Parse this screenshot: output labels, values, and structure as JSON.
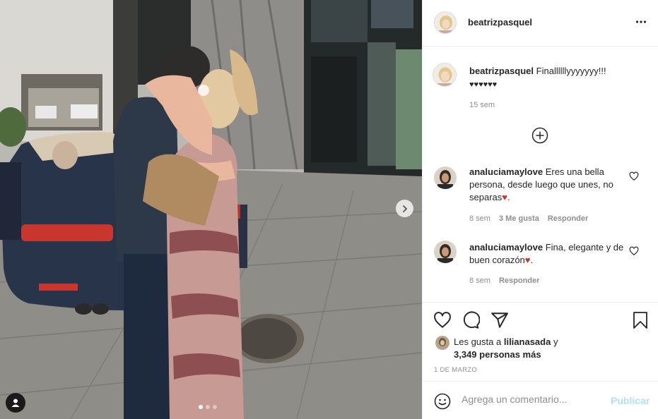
{
  "post": {
    "author": "beatrizpasquel",
    "media": {
      "slide_index": 1,
      "slide_count": 3
    }
  },
  "caption": {
    "username": "beatrizpasquel",
    "text": "Finallllllyyyyyyy!!!",
    "hearts": "♥♥♥♥♥♥",
    "age": "15 sem"
  },
  "comments": [
    {
      "username": "analuciamaylove",
      "text_before": "Eres una bella persona, desde luego que unes, no separas",
      "heart": "♥",
      "text_after": ".",
      "age": "8 sem",
      "likes": "3 Me gusta",
      "reply": "Responder"
    },
    {
      "username": "analuciamaylove",
      "text_before": "Fina, elegante y de buen corazón",
      "heart": "♥",
      "text_after": ".",
      "age": "8 sem",
      "reply": "Responder"
    }
  ],
  "likes": {
    "prefix": "Les gusta a",
    "user": "lilianasada",
    "joiner": "y",
    "others": "3,349 personas más"
  },
  "date": "1 de marzo",
  "add_comment": {
    "placeholder": "Agrega un comentario...",
    "publish": "Publicar"
  },
  "icons": {
    "header_more": "more-horizontal-icon",
    "load_more": "plus-circle-icon",
    "like": "heart-outline-icon",
    "comment": "speech-bubble-icon",
    "share": "paper-plane-icon",
    "save": "bookmark-icon",
    "emoji": "smiley-icon",
    "next": "chevron-right-icon",
    "tags": "user-tag-icon"
  },
  "colors": {
    "link_disabled": "#b2dffc",
    "muted": "#8e8e8e",
    "text": "#262626",
    "heart_red": "#c0392b"
  }
}
